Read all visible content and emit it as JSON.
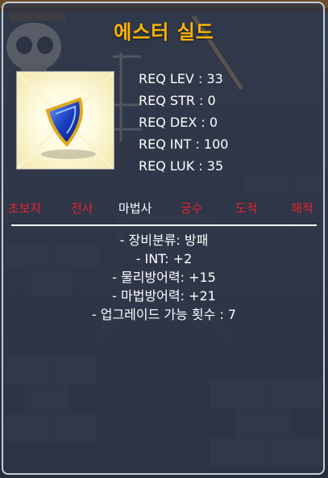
{
  "item": {
    "name": "에스터 실드",
    "icon": "shield-icon"
  },
  "requirements": [
    "REQ LEV : 33",
    "REQ STR : 0",
    "REQ DEX : 0",
    "REQ INT : 100",
    "REQ LUK : 35"
  ],
  "jobs": [
    {
      "label": "초보자",
      "color": "#e8222c"
    },
    {
      "label": "전사",
      "color": "#e8222c"
    },
    {
      "label": "마법사",
      "color": "#ffffff"
    },
    {
      "label": "궁수",
      "color": "#e8222c"
    },
    {
      "label": "도적",
      "color": "#e8222c"
    },
    {
      "label": "해적",
      "color": "#e8222c"
    }
  ],
  "stats": [
    "- 장비분류: 방패",
    "- INT: +2",
    "- 물리방어력: +15",
    "- 마법방어력: +21",
    "- 업그레이드 가능 횟수 : 7"
  ],
  "colors": {
    "title": "#ffb400",
    "unavailable_job": "#e8222c",
    "available_job": "#ffffff"
  }
}
